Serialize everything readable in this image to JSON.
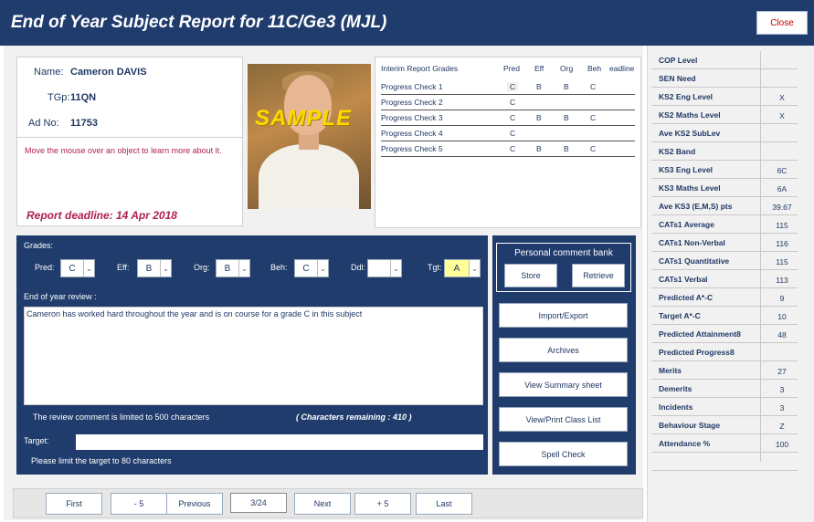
{
  "window": {
    "title": "End of Year Subject Report for 11C/Ge3 (MJL)",
    "close_label": "Close"
  },
  "student": {
    "name_label": "Name:",
    "name": "Cameron DAVIS",
    "tgp_label": "TGp:",
    "tgp": "11QN",
    "adno_label": "Ad No:",
    "adno": "11753"
  },
  "hint": "Move the mouse over an object to learn more about it.",
  "deadline": "Report deadline: 14 Apr 2018",
  "photo": {
    "overlay": "SAMPLE"
  },
  "interim": {
    "headers": [
      "Interim Report Grades",
      "Pred",
      "Eff",
      "Org",
      "Beh",
      "eadline"
    ],
    "rows": [
      {
        "name": "Progress Check 1",
        "pred": "C",
        "eff": "B",
        "org": "B",
        "beh": "C"
      },
      {
        "name": "Progress Check 2",
        "pred": "C",
        "eff": "",
        "org": "",
        "beh": ""
      },
      {
        "name": "Progress Check 3",
        "pred": "C",
        "eff": "B",
        "org": "B",
        "beh": "C"
      },
      {
        "name": "Progress Check 4",
        "pred": "C",
        "eff": "",
        "org": "",
        "beh": ""
      },
      {
        "name": "Progress Check 5",
        "pred": "C",
        "eff": "B",
        "org": "B",
        "beh": "C"
      }
    ]
  },
  "grades": {
    "heading": "Grades:",
    "fields": [
      {
        "label": "Pred:",
        "value": "C"
      },
      {
        "label": "Eff:",
        "value": "B"
      },
      {
        "label": "Org:",
        "value": "B"
      },
      {
        "label": "Beh:",
        "value": "C"
      },
      {
        "label": "Ddl:",
        "value": ""
      },
      {
        "label": "Tgt:",
        "value": "A"
      }
    ]
  },
  "review": {
    "label": "End of year review :",
    "text": "Cameron has worked hard throughout the year and is on course for a grade C in this subject",
    "limit_note": "The review comment is limited to 500 characters",
    "remaining": "( Characters remaining : 410 )"
  },
  "target": {
    "label": "Target:",
    "value": "",
    "limit_note": "Please limit the target to 80 characters"
  },
  "comment_bank": {
    "title": "Personal comment bank",
    "store": "Store",
    "retrieve": "Retrieve"
  },
  "actions": [
    "Import/Export",
    "Archives",
    "View Summary sheet",
    "View/Print Class List",
    "Spell Check"
  ],
  "nav": {
    "first": "First",
    "minus5": "- 5",
    "previous": "Previous",
    "position": "3/24",
    "next": "Next",
    "plus5": "+ 5",
    "last": "Last"
  },
  "sidebar": [
    {
      "key": "COP Level",
      "value": ""
    },
    {
      "key": "SEN Need",
      "value": ""
    },
    {
      "key": "KS2 Eng Level",
      "value": "X"
    },
    {
      "key": "KS2 Maths Level",
      "value": "X"
    },
    {
      "key": "Ave KS2 SubLev",
      "value": ""
    },
    {
      "key": "KS2 Band",
      "value": ""
    },
    {
      "key": "KS3 Eng Level",
      "value": "6C"
    },
    {
      "key": "KS3 Maths Level",
      "value": "6A"
    },
    {
      "key": "Ave KS3 (E,M,S) pts",
      "value": "39.67"
    },
    {
      "key": "CATs1 Average",
      "value": "115"
    },
    {
      "key": "CATs1 Non-Verbal",
      "value": "116"
    },
    {
      "key": "CATs1 Quantitative",
      "value": "115"
    },
    {
      "key": "CATs1 Verbal",
      "value": "113"
    },
    {
      "key": "Predicted A*-C",
      "value": "9"
    },
    {
      "key": "Target A*-C",
      "value": "10"
    },
    {
      "key": "Predicted Attainment8",
      "value": "48"
    },
    {
      "key": "Predicted Progress8",
      "value": ""
    },
    {
      "key": "Merits",
      "value": "27"
    },
    {
      "key": "Demerits",
      "value": "3"
    },
    {
      "key": "Incidents",
      "value": "3"
    },
    {
      "key": "Behaviour Stage",
      "value": "Z"
    },
    {
      "key": "Attendance %",
      "value": "100"
    },
    {
      "key": "",
      "value": ""
    }
  ],
  "colors": {
    "navy": "#1f3c6d",
    "hint": "#b02050",
    "target_highlight": "#ffff99"
  }
}
